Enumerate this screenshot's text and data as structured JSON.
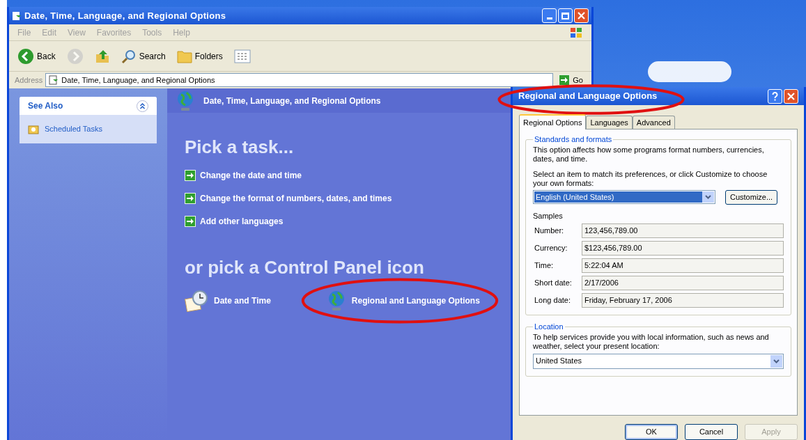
{
  "explorer": {
    "title": "Date, Time, Language, and Regional Options",
    "menu": [
      "File",
      "Edit",
      "View",
      "Favorites",
      "Tools",
      "Help"
    ],
    "toolbar": [
      {
        "kind": "back",
        "label": "Back",
        "disabled": false
      },
      {
        "kind": "forward",
        "disabled": true
      },
      {
        "kind": "up",
        "disabled": false
      },
      {
        "kind": "search",
        "label": "Search",
        "disabled": false
      },
      {
        "kind": "folders",
        "label": "Folders",
        "disabled": false
      },
      {
        "kind": "views",
        "disabled": false
      }
    ],
    "address": {
      "label": "Address",
      "value": "Date, Time, Language, and Regional Options",
      "go": "Go"
    },
    "see_also": {
      "title": "See Also",
      "items": [
        "Scheduled Tasks"
      ]
    },
    "header": "Date, Time, Language, and Regional Options",
    "pick_task": {
      "title": "Pick a task...",
      "tasks": [
        "Change the date and time",
        "Change the format of numbers, dates, and times",
        "Add other languages"
      ]
    },
    "pick_icon": {
      "title": "or pick a Control Panel icon",
      "icons": [
        {
          "kind": "clock",
          "label": "Date and Time",
          "highlighted": false
        },
        {
          "kind": "globe",
          "label": "Regional and Language Options",
          "highlighted": true
        }
      ]
    }
  },
  "dialog": {
    "title": "Regional and Language Options",
    "highlighted": true,
    "tabs": [
      {
        "label": "Regional Options",
        "selected": true
      },
      {
        "label": "Languages",
        "selected": false
      },
      {
        "label": "Advanced",
        "selected": false
      }
    ],
    "standards": {
      "legend": "Standards and formats",
      "description": "This option affects how some programs format numbers, currencies, dates, and time.",
      "prompt": "Select an item to match its preferences, or click Customize to choose your own formats:",
      "format": "English (United States)",
      "customize": "Customize...",
      "samples_label": "Samples",
      "samples": [
        {
          "label": "Number:",
          "value": "123,456,789.00"
        },
        {
          "label": "Currency:",
          "value": "$123,456,789.00"
        },
        {
          "label": "Time:",
          "value": "5:22:04 AM"
        },
        {
          "label": "Short date:",
          "value": "2/17/2006"
        },
        {
          "label": "Long date:",
          "value": "Friday, February 17, 2006"
        }
      ]
    },
    "location": {
      "legend": "Location",
      "description": "To help services provide you with local information, such as news and weather, select your present location:",
      "value": "United States"
    },
    "buttons": [
      {
        "label": "OK",
        "disabled": false,
        "default": true
      },
      {
        "label": "Cancel",
        "disabled": false,
        "default": false
      },
      {
        "label": "Apply",
        "disabled": true,
        "default": false
      }
    ]
  }
}
